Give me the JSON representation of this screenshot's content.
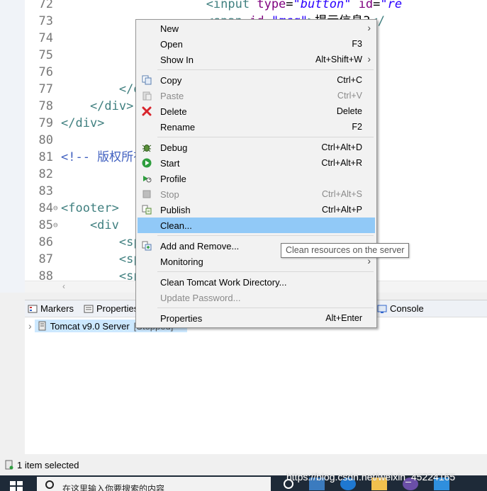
{
  "editor": {
    "lines": [
      {
        "num": "72",
        "fold": "",
        "parts": [
          {
            "c": "tag",
            "t": "                    <input "
          },
          {
            "c": "attr",
            "t": "type"
          },
          {
            "c": "txt",
            "t": "="
          },
          {
            "c": "str",
            "t": "\"button\""
          },
          {
            "c": "txt",
            "t": " "
          },
          {
            "c": "attr",
            "t": "id"
          },
          {
            "c": "txt",
            "t": "="
          },
          {
            "c": "str",
            "t": "\"re"
          }
        ]
      },
      {
        "num": "73",
        "fold": "",
        "parts": [
          {
            "c": "tag",
            "t": "                    <span "
          },
          {
            "c": "attr",
            "t": "id"
          },
          {
            "c": "txt",
            "t": "="
          },
          {
            "c": "str",
            "t": "\"msg\""
          },
          {
            "c": "tag",
            "t": ">"
          },
          {
            "c": "txt",
            "t": "提示信息3"
          },
          {
            "c": "tag",
            "t": "</"
          }
        ]
      },
      {
        "num": "74",
        "fold": "",
        "parts": []
      },
      {
        "num": "75",
        "fold": "",
        "parts": []
      },
      {
        "num": "76",
        "fold": "",
        "parts": []
      },
      {
        "num": "77",
        "fold": "",
        "parts": [
          {
            "c": "tag",
            "t": "        </div>"
          }
        ]
      },
      {
        "num": "78",
        "fold": "",
        "parts": [
          {
            "c": "tag",
            "t": "    </div>"
          }
        ]
      },
      {
        "num": "79",
        "fold": "",
        "parts": [
          {
            "c": "tag",
            "t": "</div>"
          }
        ]
      },
      {
        "num": "80",
        "fold": "",
        "parts": []
      },
      {
        "num": "81",
        "fold": "",
        "parts": [
          {
            "c": "cmt",
            "t": "<!-- 版权所有 -->"
          }
        ]
      },
      {
        "num": "82",
        "fold": "",
        "parts": []
      },
      {
        "num": "83",
        "fold": "",
        "parts": []
      },
      {
        "num": "84",
        "fold": "⊖",
        "parts": [
          {
            "c": "tag",
            "t": "<footer>"
          }
        ]
      },
      {
        "num": "85",
        "fold": "⊖",
        "parts": [
          {
            "c": "tag",
            "t": "    <div"
          }
        ]
      },
      {
        "num": "86",
        "fold": "",
        "parts": [
          {
            "c": "tag",
            "t": "        <span>              </span>"
          }
        ]
      },
      {
        "num": "87",
        "fold": "",
        "parts": [
          {
            "c": "tag",
            "t": "        <span>              </span>"
          }
        ]
      },
      {
        "num": "88",
        "fold": "",
        "parts": [
          {
            "c": "tag",
            "t": "        <span>              </span>"
          }
        ]
      }
    ],
    "scroll_arrow": "‹"
  },
  "panel": {
    "tabs": [
      {
        "label": "Markers",
        "icon": "markers-icon"
      },
      {
        "label": "Properties",
        "icon": "properties-icon"
      },
      {
        "label": "Console",
        "icon": "console-icon"
      }
    ],
    "server": {
      "expander": "›",
      "label": "Tomcat v9.0 Server",
      "suffix": "[Stopped]"
    }
  },
  "status_bar": {
    "text": "1 item selected"
  },
  "taskbar": {
    "search_placeholder": "在这里输入你要搜索的内容"
  },
  "watermark": "https://blog.csdn.net/weixin_45224165",
  "context_menu": {
    "items": [
      {
        "label": "New",
        "shortcut": "",
        "submenu": true,
        "disabled": false,
        "icon": ""
      },
      {
        "label": "Open",
        "shortcut": "F3",
        "submenu": false,
        "disabled": false,
        "icon": ""
      },
      {
        "label": "Show In",
        "shortcut": "Alt+Shift+W",
        "submenu": true,
        "disabled": false,
        "icon": ""
      },
      {
        "label": "Copy",
        "shortcut": "Ctrl+C",
        "submenu": false,
        "disabled": false,
        "icon": "copy-icon"
      },
      {
        "label": "Paste",
        "shortcut": "Ctrl+V",
        "submenu": false,
        "disabled": true,
        "icon": "paste-icon"
      },
      {
        "label": "Delete",
        "shortcut": "Delete",
        "submenu": false,
        "disabled": false,
        "icon": "delete-icon"
      },
      {
        "label": "Rename",
        "shortcut": "F2",
        "submenu": false,
        "disabled": false,
        "icon": ""
      },
      {
        "label": "Debug",
        "shortcut": "Ctrl+Alt+D",
        "submenu": false,
        "disabled": false,
        "icon": "debug-icon"
      },
      {
        "label": "Start",
        "shortcut": "Ctrl+Alt+R",
        "submenu": false,
        "disabled": false,
        "icon": "start-icon"
      },
      {
        "label": "Profile",
        "shortcut": "",
        "submenu": false,
        "disabled": false,
        "icon": "profile-icon"
      },
      {
        "label": "Stop",
        "shortcut": "Ctrl+Alt+S",
        "submenu": false,
        "disabled": true,
        "icon": "stop-icon"
      },
      {
        "label": "Publish",
        "shortcut": "Ctrl+Alt+P",
        "submenu": false,
        "disabled": false,
        "icon": "publish-icon"
      },
      {
        "label": "Clean...",
        "shortcut": "",
        "submenu": false,
        "disabled": false,
        "icon": "",
        "highlighted": true
      },
      {
        "label": "Add and Remove...",
        "shortcut": "",
        "submenu": false,
        "disabled": false,
        "icon": "add-remove-icon"
      },
      {
        "label": "Monitoring",
        "shortcut": "",
        "submenu": true,
        "disabled": false,
        "icon": ""
      },
      {
        "label": "Clean Tomcat Work Directory...",
        "shortcut": "",
        "submenu": false,
        "disabled": false,
        "icon": ""
      },
      {
        "label": "Update Password...",
        "shortcut": "",
        "submenu": false,
        "disabled": true,
        "icon": ""
      },
      {
        "label": "Properties",
        "shortcut": "Alt+Enter",
        "submenu": false,
        "disabled": false,
        "icon": ""
      }
    ],
    "tooltip": "Clean resources on the server"
  },
  "colors": {
    "highlight": "#91c9f7",
    "tag": "#3f7f7f",
    "attr": "#7f007f",
    "string": "#2a00ff",
    "comment": "#3f5fbf",
    "delete": "#d8242c",
    "start": "#2e9e3e"
  }
}
